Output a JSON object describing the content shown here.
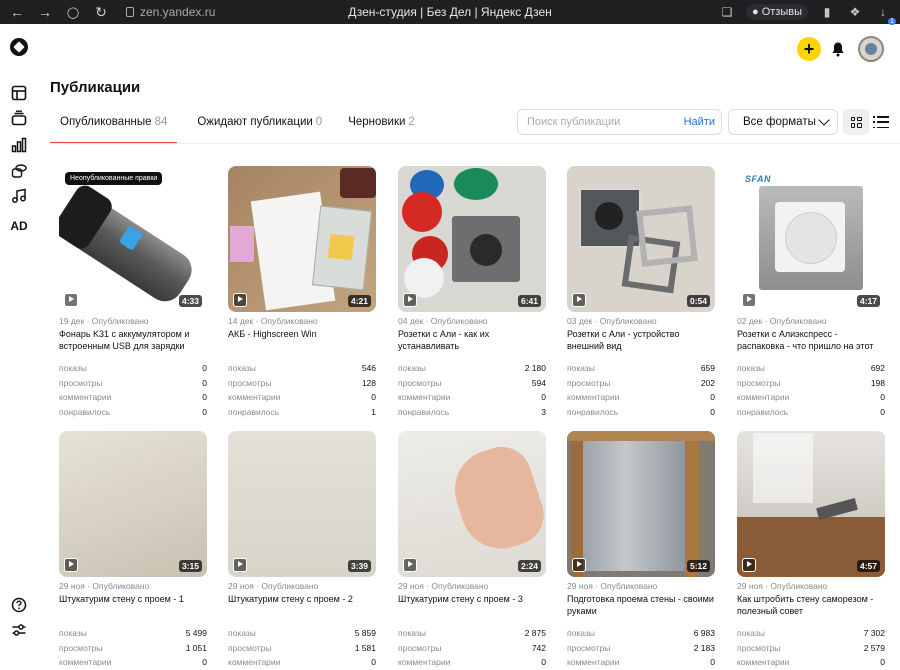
{
  "browser": {
    "url": "zen.yandex.ru",
    "title": "Дзен-студия | Без Дел | Яндекс Дзен",
    "reviews_label": "Отзывы",
    "downloads_count": "1"
  },
  "rail": {
    "bottom_label": "AD"
  },
  "header": {
    "page_title": "Публикации"
  },
  "tabs": [
    {
      "label": "Опубликованные",
      "count": "84",
      "active": true
    },
    {
      "label": "Ожидают публикации",
      "count": "0",
      "active": false
    },
    {
      "label": "Черновики",
      "count": "2",
      "active": false
    }
  ],
  "search": {
    "placeholder": "Поиск публикации",
    "button": "Найти"
  },
  "formats": {
    "label": "Все форматы"
  },
  "stat_labels": {
    "shows": "показы",
    "views": "просмотры",
    "comments": "комментарии",
    "likes": "понравилось"
  },
  "cards": [
    {
      "date": "19 дек · Опубликовано",
      "title": "Фонарь K31 с аккумулятором и встроенным USB для зарядки",
      "duration": "4:33",
      "badge": "Неопубликованные правки",
      "shows": "0",
      "views": "0",
      "comments": "0",
      "likes": "0"
    },
    {
      "date": "14 дек · Опубликовано",
      "title": "АКБ - Highscreen Win",
      "duration": "4:21",
      "shows": "546",
      "views": "128",
      "comments": "0",
      "likes": "1"
    },
    {
      "date": "04 дек · Опубликовано",
      "title": "Розетки с Али - как их устанавливать",
      "duration": "6:41",
      "shows": "2 180",
      "views": "594",
      "comments": "0",
      "likes": "3"
    },
    {
      "date": "03 дек · Опубликовано",
      "title": "Розетки с Али - устройство внешний вид",
      "duration": "0:54",
      "shows": "659",
      "views": "202",
      "comments": "0",
      "likes": "0"
    },
    {
      "date": "02 дек · Опубликовано",
      "title": "Розетки с Алиэкспресс - распаковка - что пришло на этот раз",
      "duration": "4:17",
      "thumb_logo": "SFAN",
      "shows": "692",
      "views": "198",
      "comments": "0",
      "likes": "0"
    },
    {
      "date": "29 ноя · Опубликовано",
      "title": "Штукатурим стену с проем - 1",
      "duration": "3:15",
      "shows": "5 499",
      "views": "1 051",
      "comments": "0"
    },
    {
      "date": "29 ноя · Опубликовано",
      "title": "Штукатурим стену с проем - 2",
      "duration": "3:39",
      "shows": "5 859",
      "views": "1 581",
      "comments": "0"
    },
    {
      "date": "29 ноя · Опубликовано",
      "title": "Штукатурим стену с проем - 3",
      "duration": "2:24",
      "shows": "2 875",
      "views": "742",
      "comments": "0"
    },
    {
      "date": "29 ноя · Опубликовано",
      "title": "Подготовка проема стены - своими руками",
      "duration": "5:12",
      "shows": "6 983",
      "views": "2 183",
      "comments": "0"
    },
    {
      "date": "29 ноя · Опубликовано",
      "title": "Как штробить стену саморезом - полезный совет",
      "duration": "4:57",
      "shows": "7 302",
      "views": "2 579",
      "comments": "0"
    }
  ],
  "colors": {
    "accent_tab": "#e54646",
    "create_button": "#ffd400",
    "link": "#2b6cd3"
  }
}
